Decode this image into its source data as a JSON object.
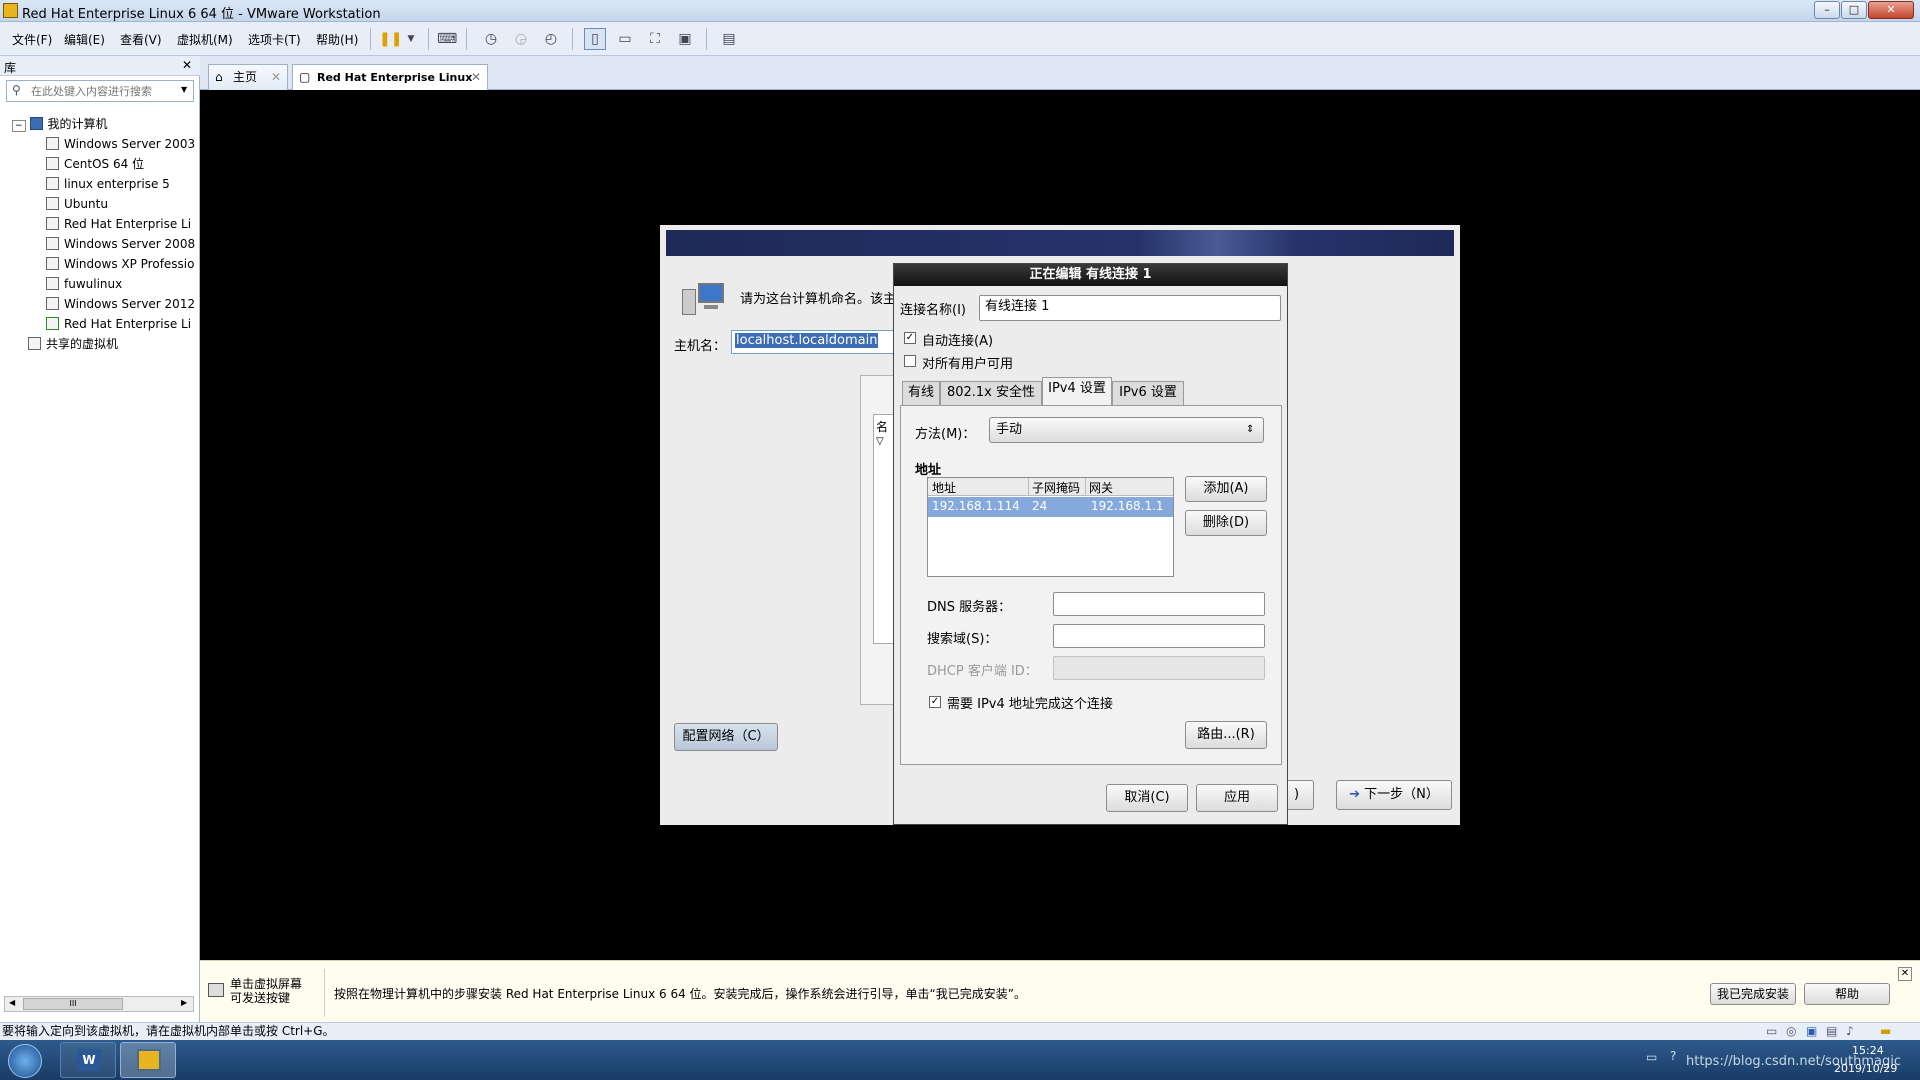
{
  "window": {
    "title": "Red Hat Enterprise Linux 6 64 位 - VMware Workstation",
    "min": "–",
    "max": "□",
    "close": "✕"
  },
  "menu": [
    "文件(F)",
    "编辑(E)",
    "查看(V)",
    "虚拟机(M)",
    "选项卡(T)",
    "帮助(H)"
  ],
  "library": {
    "title": "库",
    "close": "✕",
    "search_placeholder": "在此处键入内容进行搜索",
    "root": "我的计算机",
    "vms": [
      "Windows Server 2003",
      "CentOS 64 位",
      "linux enterprise 5",
      "Ubuntu",
      "Red Hat Enterprise Li",
      "Windows Server 2008",
      "Windows XP Professio",
      "fuwulinux",
      "Windows Server 2012",
      "Red Hat Enterprise Li"
    ],
    "shared": "共享的虚拟机",
    "scroll_mid": "III"
  },
  "tabs": [
    {
      "label": "主页"
    },
    {
      "label": "Red Hat Enterprise Linux ..."
    }
  ],
  "installer": {
    "prompt": "请为这台计算机命名。该主",
    "hostname_label": "主机名：",
    "hostname_value": "localhost.localdomain",
    "config_network": "配置网络（C）",
    "back_partial": ")",
    "next": "下一步（N）",
    "list_header_partial": "名"
  },
  "dialog": {
    "title": "正在编辑 有线连接 1",
    "conn_name_label": "连接名称(I)",
    "conn_name_value": "有线连接 1",
    "auto_connect": "自动连接(A)",
    "all_users": "对所有用户可用",
    "tabs": [
      "有线",
      "802.1x 安全性",
      "IPv4 设置",
      "IPv6 设置"
    ],
    "method_label": "方法(M)：",
    "method_value": "手动",
    "address_section": "地址",
    "columns": [
      "地址",
      "子网掩码",
      "网关"
    ],
    "rows": [
      {
        "address": "192.168.1.114",
        "netmask": "24",
        "gateway": "192.168.1.1"
      }
    ],
    "add": "添加(A)",
    "delete": "删除(D)",
    "dns_label": "DNS 服务器：",
    "search_domain_label": "搜索域(S)：",
    "dhcp_id_label": "DHCP 客户端 ID：",
    "require_ipv4": "需要 IPv4 地址完成这个连接",
    "routes": "路由...(R)",
    "cancel": "取消(C)",
    "apply": "应用"
  },
  "hint": {
    "left_line1": "单击虚拟屏幕",
    "left_line2": "可发送按键",
    "message": "按照在物理计算机中的步骤安装 Red Hat Enterprise Linux 6 64 位。安装完成后，操作系统会进行引导，单击“我已完成安装”。",
    "done_button": "我已完成安装",
    "help_button": "帮助",
    "close": "✕"
  },
  "statusbar": {
    "text": "要将输入定向到该虚拟机，请在虚拟机内部单击或按 Ctrl+G。"
  },
  "taskbar": {
    "time": "15:24",
    "date": "2019/10/29",
    "watermark": "https://blog.csdn.net/southmagic",
    "word_label": "W"
  }
}
